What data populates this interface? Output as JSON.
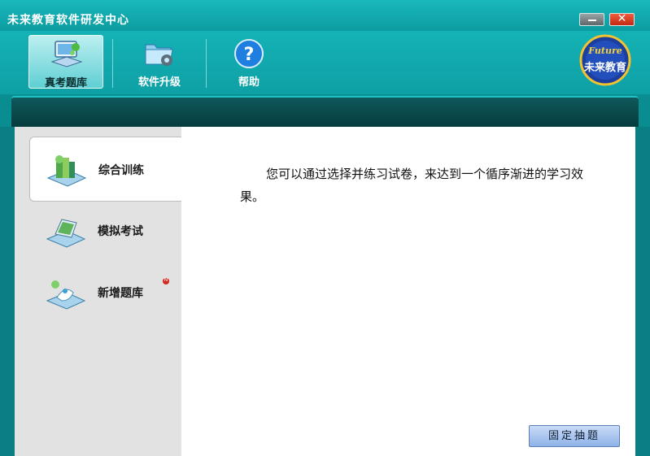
{
  "window": {
    "title": "未来教育软件研发中心",
    "close_glyph": "✕"
  },
  "toolbar": {
    "items": [
      {
        "label": "真考题库",
        "icon": "computer-questionbank-icon",
        "active": true
      },
      {
        "label": "软件升级",
        "icon": "folder-gear-icon",
        "active": false
      },
      {
        "label": "帮助",
        "icon": "help-question-icon",
        "active": false
      }
    ]
  },
  "logo": {
    "line1": "Future",
    "line2": "未来教育"
  },
  "sidebar": {
    "items": [
      {
        "label": "综合训练",
        "icon": "books-training-icon",
        "active": true
      },
      {
        "label": "模拟考试",
        "icon": "laptop-exam-icon",
        "active": false
      },
      {
        "label": "新增题库",
        "icon": "new-questionbank-icon",
        "active": false,
        "badge": "N"
      }
    ]
  },
  "content": {
    "description": "您可以通过选择并练习试卷，来达到一个循序渐进的学习效果。",
    "fixed_button": "固定抽题"
  },
  "colors": {
    "frame": "#0fa6ab",
    "band": "#053c3e",
    "sidebar": "#e2e2e2",
    "button": "#8fb2e8"
  }
}
